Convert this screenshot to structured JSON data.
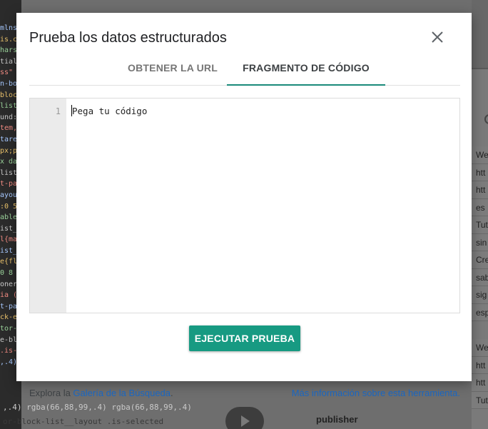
{
  "dialog": {
    "title": "Prueba los datos estructurados",
    "tabs": [
      {
        "label": "OBTENER LA URL",
        "active": false
      },
      {
        "label": "FRAGMENTO DE CÓDIGO",
        "active": true
      }
    ],
    "editor": {
      "line_number": "1",
      "placeholder": "Pega tu código"
    },
    "run_button": "EJECUTAR PRUEBA",
    "footer": {
      "prefix": "Explora la ",
      "gallery_link": "Galería de la Búsqueda",
      "suffix": ".",
      "more_info_link": "Más información sobre esta herramienta."
    }
  },
  "background": {
    "code_fragments": [
      "mlns",
      "is.c",
      "hars",
      "tial",
      "ss\"",
      "n-bo",
      "bloc",
      "list",
      "und:",
      "tem,",
      "tare",
      "px;p",
      "x da",
      "list",
      "t-pa",
      "ayou",
      ":0 5",
      "able",
      "ist_",
      "l{ma",
      "ist_",
      "e{fl",
      " 0 8",
      "oner",
      "ia (",
      "t-pa",
      "ck-e",
      "tor-",
      "e-bl",
      ".is-",
      ",.4)"
    ],
    "bottom_code": [
      ",.4) rgba(66,88,99,.4) rgba(66,88,99,.4)",
      "or-block-list__layout .is-selected"
    ],
    "publisher": "publisher",
    "right_texts": [
      "We",
      "htt",
      "htt",
      "es",
      "Tut",
      "sin",
      "Cre",
      "sab",
      "sig",
      "esp"
    ],
    "right_texts_2": [
      "We",
      "htt",
      "htt",
      "Tut"
    ],
    "colors": {
      "accent": "#179a82",
      "link": "#1a66c0",
      "tab_underline": "#1a8a7a"
    }
  }
}
